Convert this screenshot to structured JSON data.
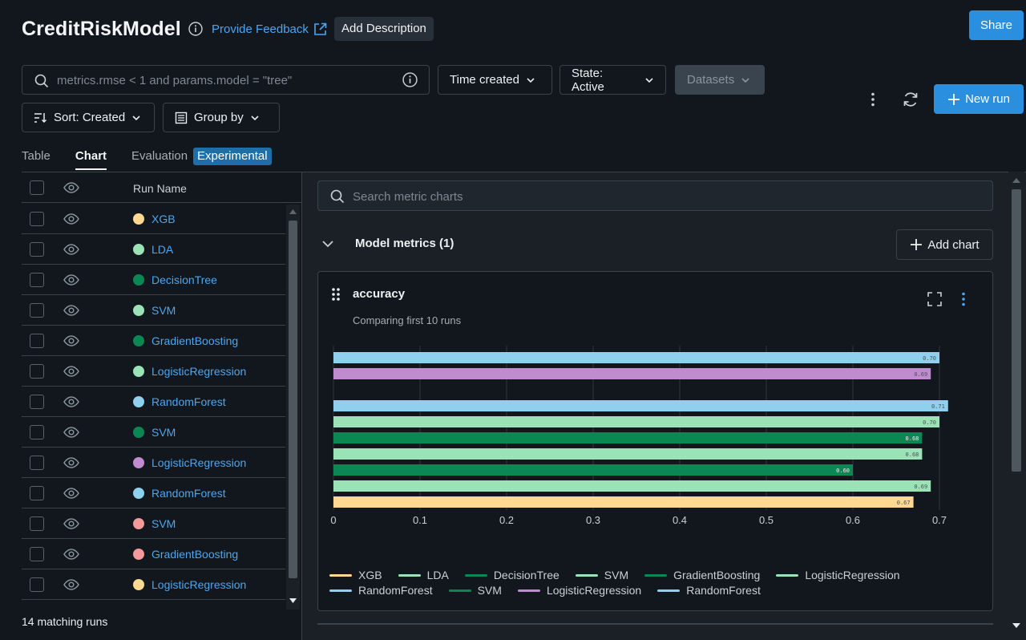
{
  "header": {
    "title": "CreditRiskModel",
    "feedback": "Provide Feedback",
    "add_description": "Add Description",
    "share": "Share"
  },
  "filters": {
    "search_placeholder": "metrics.rmse < 1 and params.model = \"tree\"",
    "time_created": "Time created",
    "state": "State: Active",
    "datasets": "Datasets",
    "sort": "Sort: Created",
    "group_by": "Group by",
    "new_run": "New run"
  },
  "tabs": [
    {
      "label": "Table",
      "active": false
    },
    {
      "label": "Chart",
      "active": true
    },
    {
      "label": "Evaluation",
      "active": false
    }
  ],
  "experimental_badge": "Experimental",
  "runs_table": {
    "column_header": "Run Name",
    "rows": [
      {
        "name": "XGB",
        "color": "#ffd891"
      },
      {
        "name": "LDA",
        "color": "#9be3b6"
      },
      {
        "name": "DecisionTree",
        "color": "#0b8754"
      },
      {
        "name": "SVM",
        "color": "#9be3b6"
      },
      {
        "name": "GradientBoosting",
        "color": "#0b8754"
      },
      {
        "name": "LogisticRegression",
        "color": "#9be3b6"
      },
      {
        "name": "RandomForest",
        "color": "#8fd0ee"
      },
      {
        "name": "SVM",
        "color": "#0b8754"
      },
      {
        "name": "LogisticRegression",
        "color": "#c18bd0"
      },
      {
        "name": "RandomForest",
        "color": "#8fd0ee"
      },
      {
        "name": "SVM",
        "color": "#f49a9a"
      },
      {
        "name": "GradientBoosting",
        "color": "#f49a9a"
      },
      {
        "name": "LogisticRegression",
        "color": "#ffd891"
      }
    ],
    "matching_runs": "14 matching runs"
  },
  "chart_panel": {
    "search_placeholder": "Search metric charts",
    "section_title": "Model metrics (1)",
    "add_chart": "Add chart",
    "card_title": "accuracy",
    "card_subtitle": "Comparing first 10 runs"
  },
  "chart_data": {
    "type": "bar",
    "orientation": "horizontal",
    "title": "accuracy",
    "subtitle": "Comparing first 10 runs",
    "xlim": [
      0,
      0.7
    ],
    "xticks": [
      "0",
      "0.1",
      "0.2",
      "0.3",
      "0.4",
      "0.5",
      "0.6",
      "0.7"
    ],
    "grid": true,
    "legend_placement": "bottom",
    "bars": [
      {
        "name": "RandomForest",
        "value": 0.7,
        "label": "0.70",
        "color": "#8fd0ee"
      },
      {
        "name": "LogisticRegression",
        "value": 0.69,
        "label": "0.69",
        "color": "#c18bd0"
      },
      {
        "name": "RandomForest",
        "value": 0.71,
        "label": "0.71",
        "color": "#8fd0ee"
      },
      {
        "name": "LogisticRegression",
        "value": 0.7,
        "label": "0.70",
        "color": "#9be3b6"
      },
      {
        "name": "GradientBoosting",
        "value": 0.68,
        "label": "0.68",
        "color": "#0b8754"
      },
      {
        "name": "SVM",
        "value": 0.68,
        "label": "0.68",
        "color": "#9be3b6"
      },
      {
        "name": "DecisionTree",
        "value": 0.6,
        "label": "0.60",
        "color": "#0b8754"
      },
      {
        "name": "LDA",
        "value": 0.69,
        "label": "0.69",
        "color": "#9be3b6"
      },
      {
        "name": "XGB",
        "value": 0.67,
        "label": "0.67",
        "color": "#ffd891"
      }
    ],
    "legend": [
      {
        "name": "XGB",
        "color": "#ffd891"
      },
      {
        "name": "LDA",
        "color": "#9be3b6"
      },
      {
        "name": "DecisionTree",
        "color": "#0b8754"
      },
      {
        "name": "SVM",
        "color": "#9be3b6"
      },
      {
        "name": "GradientBoosting",
        "color": "#0b8754"
      },
      {
        "name": "LogisticRegression",
        "color": "#9be3b6"
      },
      {
        "name": "RandomForest",
        "color": "#8fd0ee"
      },
      {
        "name": "SVM",
        "color": "#0b8754"
      },
      {
        "name": "LogisticRegression",
        "color": "#c18bd0"
      },
      {
        "name": "RandomForest",
        "color": "#8fd0ee"
      }
    ]
  }
}
